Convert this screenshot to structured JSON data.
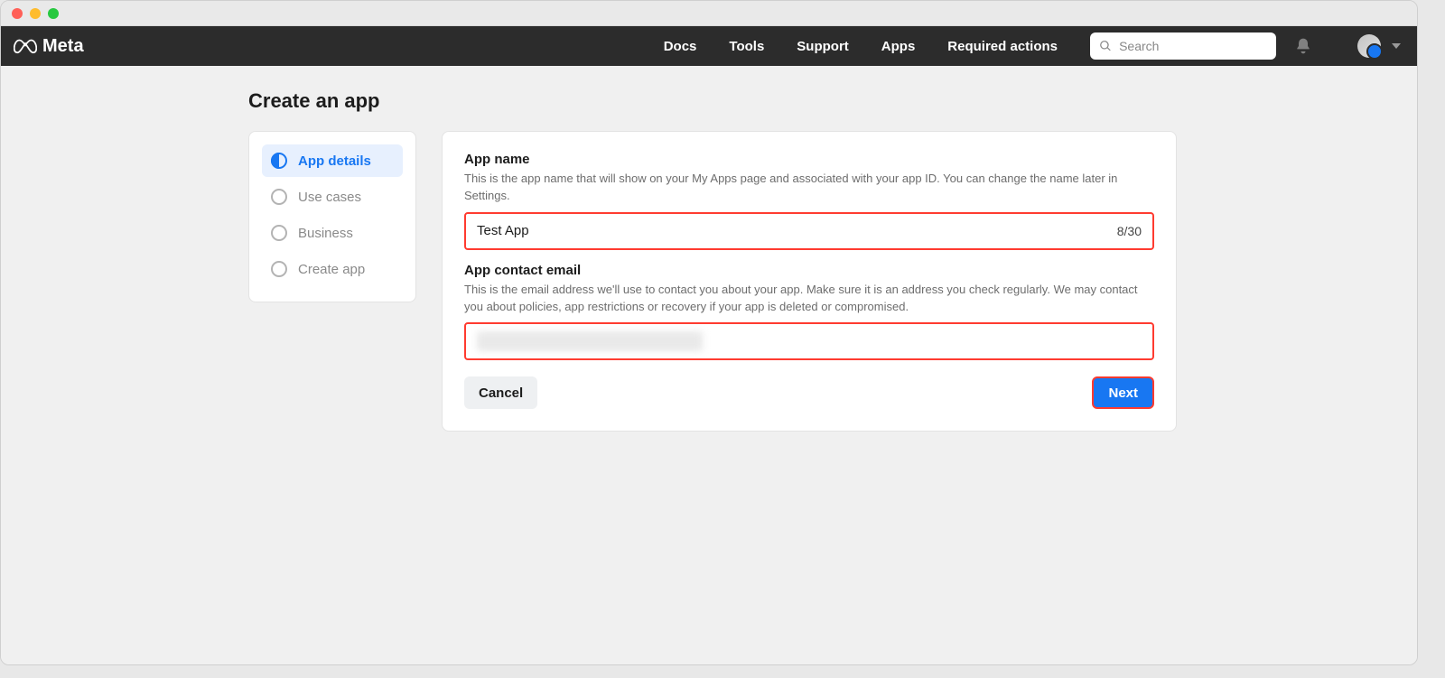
{
  "brand": "Meta",
  "nav": {
    "links": [
      "Docs",
      "Tools",
      "Support",
      "Apps",
      "Required actions"
    ],
    "search_placeholder": "Search"
  },
  "page_title": "Create an app",
  "steps": [
    {
      "label": "App details",
      "active": true
    },
    {
      "label": "Use cases",
      "active": false
    },
    {
      "label": "Business",
      "active": false
    },
    {
      "label": "Create app",
      "active": false
    }
  ],
  "form": {
    "app_name": {
      "label": "App name",
      "help": "This is the app name that will show on your My Apps page and associated with your app ID. You can change the name later in Settings.",
      "value": "Test App",
      "counter": "8/30"
    },
    "email": {
      "label": "App contact email",
      "help": "This is the email address we'll use to contact you about your app. Make sure it is an address you check regularly. We may contact you about policies, app restrictions or recovery if your app is deleted or compromised."
    },
    "cancel_label": "Cancel",
    "next_label": "Next"
  }
}
